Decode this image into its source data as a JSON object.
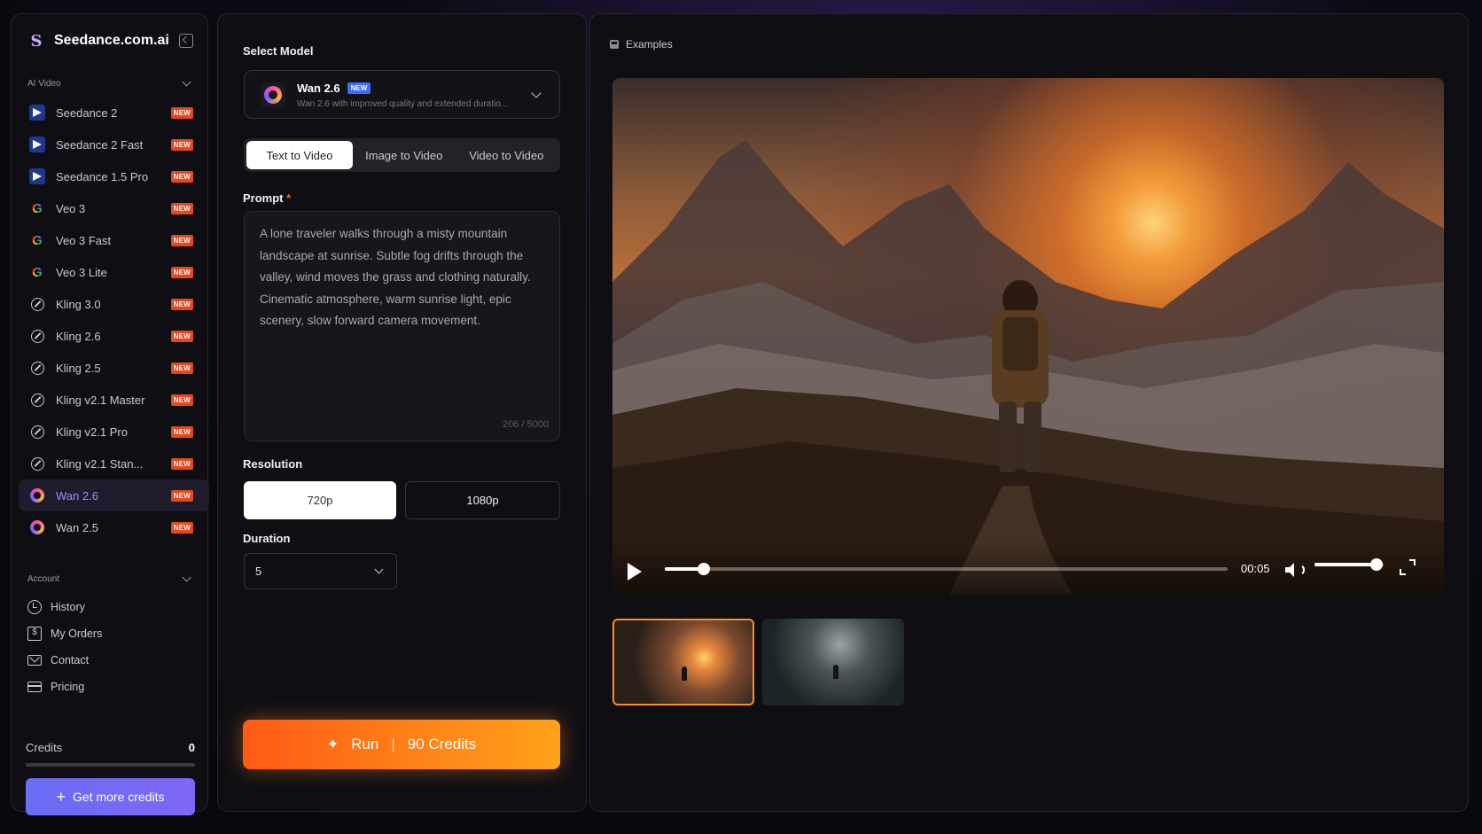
{
  "sidebar": {
    "brand": "Seedance.com.ai",
    "brand_logo_glyph": "S",
    "section_ai_video": "AI Video",
    "models": [
      {
        "label": "Seedance 2",
        "icon": "seedance-icon",
        "badge": "NEW"
      },
      {
        "label": "Seedance 2 Fast",
        "icon": "seedance-icon",
        "badge": "NEW"
      },
      {
        "label": "Seedance 1.5 Pro",
        "icon": "seedance-icon",
        "badge": "NEW"
      },
      {
        "label": "Veo 3",
        "icon": "google-icon",
        "badge": "NEW"
      },
      {
        "label": "Veo 3 Fast",
        "icon": "google-icon",
        "badge": "NEW"
      },
      {
        "label": "Veo 3 Lite",
        "icon": "google-icon",
        "badge": "NEW"
      },
      {
        "label": "Kling 3.0",
        "icon": "kling-icon",
        "badge": "NEW"
      },
      {
        "label": "Kling 2.6",
        "icon": "kling-icon",
        "badge": "NEW"
      },
      {
        "label": "Kling 2.5",
        "icon": "kling-icon",
        "badge": "NEW"
      },
      {
        "label": "Kling v2.1 Master",
        "icon": "kling-icon",
        "badge": "NEW"
      },
      {
        "label": "Kling v2.1 Pro",
        "icon": "kling-icon",
        "badge": "NEW"
      },
      {
        "label": "Kling v2.1 Stan...",
        "icon": "kling-icon",
        "badge": "NEW"
      },
      {
        "label": "Wan 2.6",
        "icon": "wan-icon",
        "badge": "NEW",
        "active": true
      },
      {
        "label": "Wan 2.5",
        "icon": "wan-icon",
        "badge": "NEW"
      }
    ],
    "section_account": "Account",
    "account_items": [
      {
        "label": "History",
        "icon": "history-icon"
      },
      {
        "label": "My Orders",
        "icon": "orders-icon"
      },
      {
        "label": "Contact",
        "icon": "mail-icon"
      },
      {
        "label": "Pricing",
        "icon": "card-icon"
      }
    ],
    "credits_label": "Credits",
    "credits_value": "0",
    "get_credits_label": "Get more credits",
    "get_credits_plus": "+"
  },
  "form": {
    "select_model_label": "Select Model",
    "selected_model": {
      "name": "Wan 2.6",
      "badge": "NEW",
      "description": "Wan 2.6 with improved quality and extended duratio..."
    },
    "tabs": [
      "Text to Video",
      "Image to Video",
      "Video to Video"
    ],
    "active_tab": "Text to Video",
    "prompt_label": "Prompt",
    "prompt_required": "*",
    "prompt_value": "A lone traveler walks through a misty mountain landscape at sunrise. Subtle fog drifts through the valley, wind moves the grass and clothing naturally. Cinematic atmosphere, warm sunrise light, epic scenery, slow forward camera movement.",
    "prompt_count": "206 / 5000",
    "resolution_label": "Resolution",
    "resolution_options": [
      "720p",
      "1080p"
    ],
    "resolution_selected": "720p",
    "duration_label": "Duration",
    "duration_value": "5",
    "run_label": "Run",
    "run_separator": "|",
    "run_credits": "90 Credits"
  },
  "examples": {
    "header": "Examples",
    "player": {
      "time": "00:05",
      "progress": 0.07,
      "volume": 0.9
    },
    "thumbnails": [
      {
        "name": "example-thumb-1",
        "selected": true
      },
      {
        "name": "example-thumb-2",
        "selected": false
      }
    ]
  },
  "colors": {
    "accent_purple": "#6b6cf5",
    "badge_red": "#e5481f",
    "run_orange_start": "#ff5a14",
    "run_orange_end": "#ffa21a",
    "active_model_text": "#a48bff"
  }
}
